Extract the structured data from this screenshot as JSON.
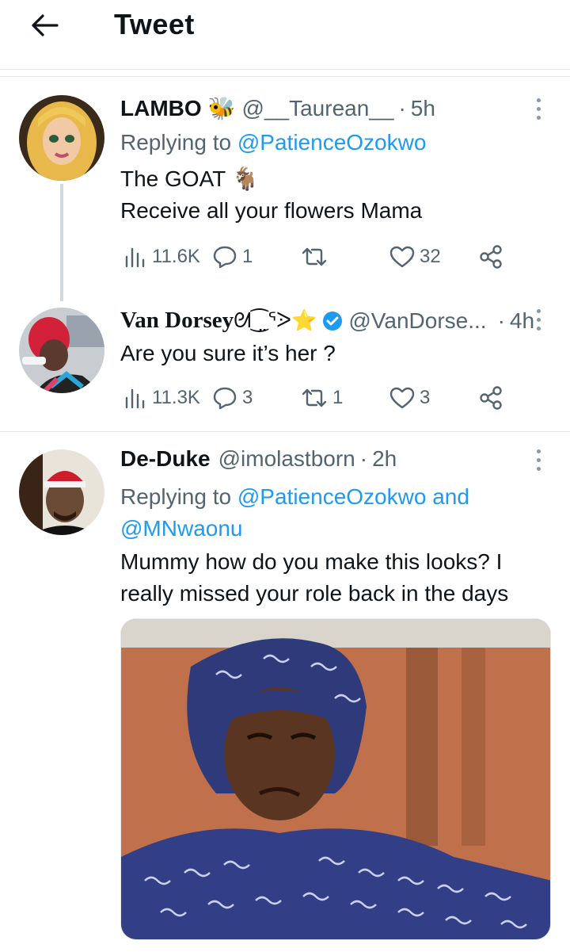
{
  "header": {
    "title": "Tweet"
  },
  "tweets": [
    {
      "name": "LAMBO",
      "name_emoji": "🐝",
      "handle": "@__Taurean__",
      "time": "5h",
      "replying_to_label": "Replying to",
      "replying_to": "@PatienceOzokwo",
      "lines": [
        "The GOAT 🐐",
        "Receive all your flowers Mama"
      ],
      "stats": {
        "views": "11.6K",
        "replies": "1",
        "retweets": "",
        "likes": "32"
      }
    },
    {
      "name": "Van Dorsey",
      "name_emoji": "ᘛ⁐̤ᕐᐷ⭐",
      "handle": "@VanDorse...",
      "time": "4h",
      "lines": [
        "Are you sure it’s her ?"
      ],
      "stats": {
        "views": "11.3K",
        "replies": "3",
        "retweets": "1",
        "likes": "3"
      }
    },
    {
      "name": "De-Duke",
      "handle": "@imolastborn",
      "time": "2h",
      "replying_to_label": "Replying to",
      "replying_to": "@PatienceOzokwo",
      "replying_and": "and",
      "replying_to_2": "@MNwaonu",
      "lines": [
        "Mummy how do you make this looks? I",
        "really missed your role back in the days"
      ]
    }
  ],
  "separator_dot": "·",
  "colors": {
    "accent": "#1d9bf0",
    "muted": "#536471",
    "text": "#0f1419",
    "verified": "#1d9bf0"
  }
}
